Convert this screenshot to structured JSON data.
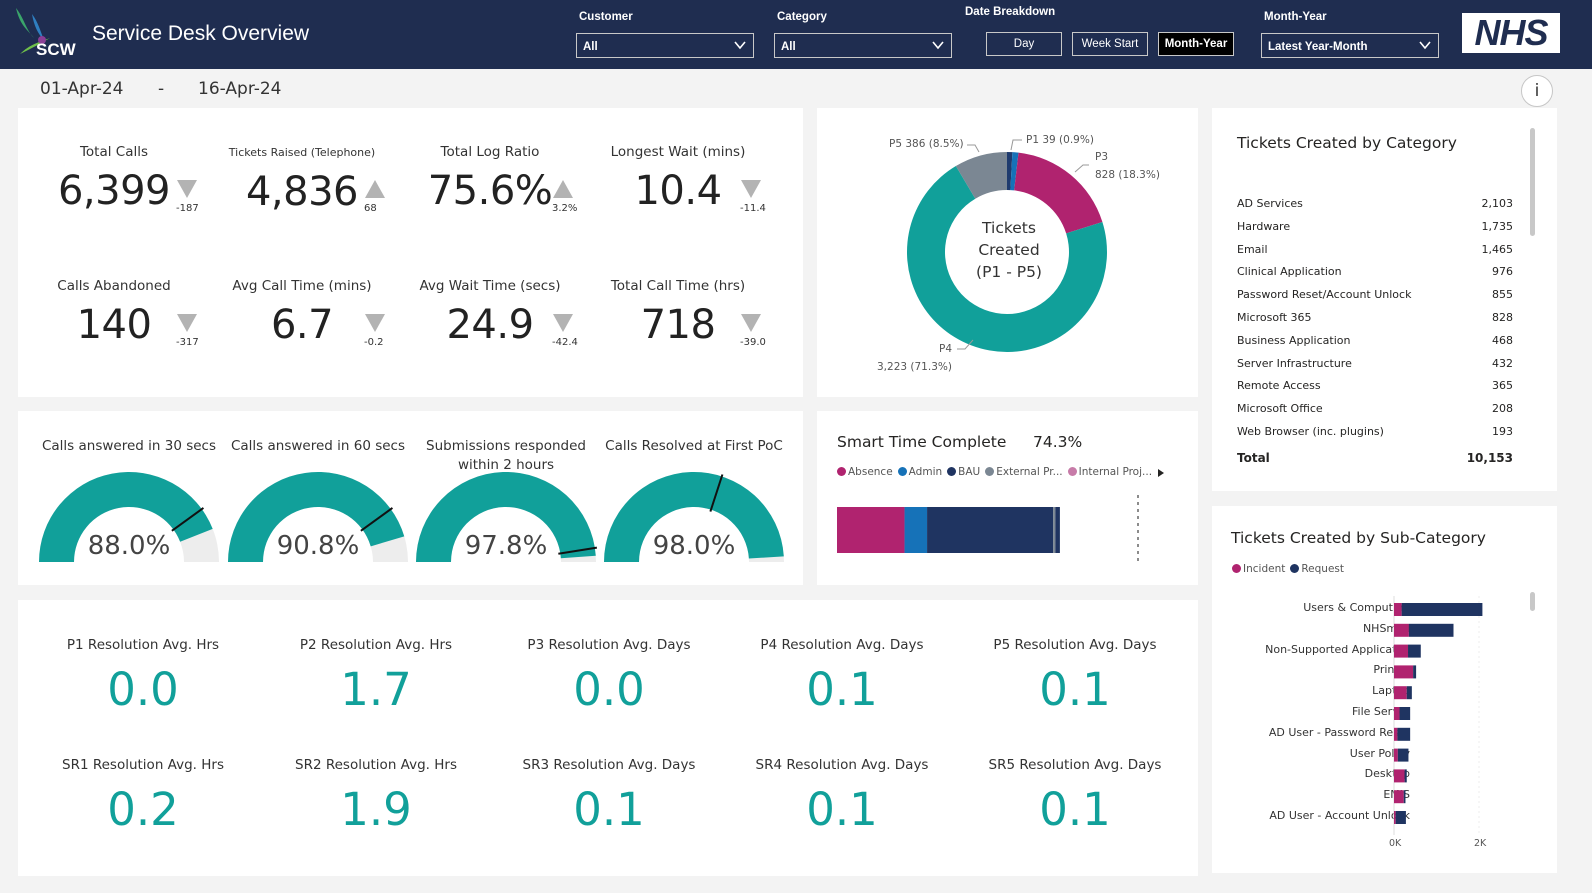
{
  "header": {
    "app_title": "Service Desk Overview",
    "logo_text": "SCW",
    "brand_badge": "NHS",
    "filters": {
      "customer_label": "Customer",
      "customer_value": "All",
      "category_label": "Category",
      "category_value": "All",
      "date_breakdown_label": "Date Breakdown",
      "date_buttons": [
        "Day",
        "Week Start",
        "Month-Year"
      ],
      "active_date_button": "Month-Year",
      "month_year_label": "Month-Year",
      "month_year_value": "Latest Year-Month"
    }
  },
  "date_range": {
    "start": "01-Apr-24",
    "separator": "-",
    "end": "16-Apr-24"
  },
  "info_button": "i",
  "kpis": [
    {
      "label": "Total Calls",
      "value": "6,399",
      "delta": "-187",
      "direction": "down"
    },
    {
      "label": "Tickets Raised (Telephone)",
      "value": "4,836",
      "delta": "68",
      "direction": "up"
    },
    {
      "label": "Total Log Ratio",
      "value": "75.6%",
      "delta": "3.2%",
      "direction": "up"
    },
    {
      "label": "Longest Wait (mins)",
      "value": "10.4",
      "delta": "-11.4",
      "direction": "down"
    },
    {
      "label": "Calls Abandoned",
      "value": "140",
      "delta": "-317",
      "direction": "down"
    },
    {
      "label": "Avg Call Time (mins)",
      "value": "6.7",
      "delta": "-0.2",
      "direction": "down"
    },
    {
      "label": "Avg Wait Time (secs)",
      "value": "24.9",
      "delta": "-42.4",
      "direction": "down"
    },
    {
      "label": "Total Call Time (hrs)",
      "value": "718",
      "delta": "-39.0",
      "direction": "down"
    }
  ],
  "donut": {
    "center_line1": "Tickets",
    "center_line2": "Created",
    "center_line3": "(P1 - P5)",
    "slices": [
      {
        "label": "P1 39 (0.9%)",
        "value": 39,
        "color": "#1f3b6e"
      },
      {
        "label_name": "P3",
        "label_value": "828 (18.3%)",
        "value": 828,
        "color": "#b0236f"
      },
      {
        "label_name": "P4",
        "label_value": "3,223 (71.3%)",
        "value": 3223,
        "color": "#11a09a"
      },
      {
        "label": "P5 386 (8.5%)",
        "value": 386,
        "color": "#7b8793"
      },
      {
        "value": 44,
        "color": "#1672b8"
      }
    ]
  },
  "gauges": [
    {
      "label": "Calls answered in 30 secs",
      "value": "88.0%",
      "pct": 0.88,
      "target": 0.8
    },
    {
      "label": "Calls answered in 60 secs",
      "value": "90.8%",
      "pct": 0.908,
      "target": 0.8
    },
    {
      "label": "Submissions responded within 2 hours",
      "value": "97.8%",
      "pct": 0.978,
      "target": 0.95
    },
    {
      "label": "Calls Resolved at First PoC",
      "value": "98.0%",
      "pct": 0.98,
      "target": 0.6
    }
  ],
  "smart_time": {
    "title": "Smart Time Complete",
    "value": "74.3%",
    "legend": [
      {
        "label": "Absence",
        "color": "#b0236f"
      },
      {
        "label": "Admin",
        "color": "#1672b8"
      },
      {
        "label": "BAU",
        "color": "#1f3461"
      },
      {
        "label": "External Pr...",
        "color": "#7b8793"
      },
      {
        "label": "Internal Proj...",
        "color": "#c77ba8"
      }
    ],
    "segments": [
      {
        "name": "Absence",
        "value": 0.3,
        "color": "#b0236f"
      },
      {
        "name": "Admin",
        "value": 0.1,
        "color": "#1672b8"
      },
      {
        "name": "BAU",
        "value": 0.56,
        "color": "#1f3461"
      },
      {
        "name": "External Pr...",
        "value": 0.01,
        "color": "#7b8793"
      },
      {
        "name": "Internal Proj...",
        "value": 0.02,
        "color": "#1f3461"
      }
    ],
    "bar_total": 0.743
  },
  "resolution": [
    {
      "label": "P1 Resolution Avg. Hrs",
      "value": "0.0"
    },
    {
      "label": "P2 Resolution Avg. Hrs",
      "value": "1.7"
    },
    {
      "label": "P3 Resolution Avg. Days",
      "value": "0.0"
    },
    {
      "label": "P4 Resolution Avg. Days",
      "value": "0.1"
    },
    {
      "label": "P5 Resolution Avg. Days",
      "value": "0.1"
    },
    {
      "label": "SR1 Resolution Avg. Hrs",
      "value": "0.2"
    },
    {
      "label": "SR2 Resolution Avg. Hrs",
      "value": "1.9"
    },
    {
      "label": "SR3 Resolution Avg. Days",
      "value": "0.1"
    },
    {
      "label": "SR4 Resolution Avg. Days",
      "value": "0.1"
    },
    {
      "label": "SR5 Resolution Avg. Days",
      "value": "0.1"
    }
  ],
  "category_table": {
    "title": "Tickets Created by Category",
    "rows": [
      {
        "name": "AD Services",
        "value": "2,103"
      },
      {
        "name": "Hardware",
        "value": "1,735"
      },
      {
        "name": "Email",
        "value": "1,465"
      },
      {
        "name": "Clinical Application",
        "value": "976"
      },
      {
        "name": "Password Reset/Account Unlock",
        "value": "855"
      },
      {
        "name": "Microsoft 365",
        "value": "828"
      },
      {
        "name": "Business Application",
        "value": "468"
      },
      {
        "name": "Server Infrastructure",
        "value": "432"
      },
      {
        "name": "Remote Access",
        "value": "365"
      },
      {
        "name": "Microsoft Office",
        "value": "208"
      },
      {
        "name": "Web Browser (inc. plugins)",
        "value": "193"
      }
    ],
    "total_label": "Total",
    "total_value": "10,153"
  },
  "subcategory_chart": {
    "title": "Tickets Created by Sub-Category",
    "legend": [
      {
        "label": "Incident",
        "color": "#b0236f"
      },
      {
        "label": "Request",
        "color": "#1f3461"
      }
    ],
    "axis_ticks": [
      "0K",
      "2K"
    ]
  },
  "chart_data": {
    "type": "bar",
    "orientation": "horizontal",
    "stacked": true,
    "categories": [
      "Users & Computers",
      "NHSmail",
      "Non-Supported Applicati...",
      "Printer",
      "Laptop",
      "File Server",
      "AD User - Password Reset",
      "User Policy",
      "Desktop",
      "EMIS",
      "AD User - Account Unlock"
    ],
    "series": [
      {
        "name": "Incident",
        "color": "#b0236f",
        "values": [
          180,
          350,
          330,
          450,
          300,
          130,
          80,
          90,
          250,
          230,
          40
        ]
      },
      {
        "name": "Request",
        "color": "#1f3461",
        "values": [
          1900,
          1050,
          300,
          70,
          120,
          250,
          300,
          250,
          50,
          40,
          240
        ]
      }
    ],
    "xlim": [
      0,
      2000
    ]
  }
}
